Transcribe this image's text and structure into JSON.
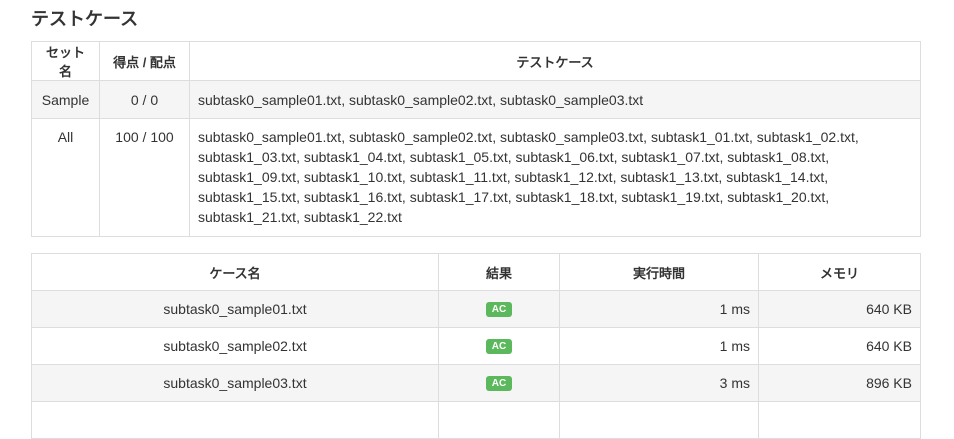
{
  "section_title": "テストケース",
  "sets_table": {
    "headers": [
      "セット名",
      "得点 / 配点",
      "テストケース"
    ],
    "rows": [
      {
        "name": "Sample",
        "score": "0 / 0",
        "cases": [
          "subtask0_sample01.txt",
          "subtask0_sample02.txt",
          "subtask0_sample03.txt"
        ]
      },
      {
        "name": "All",
        "score": "100 / 100",
        "cases": [
          "subtask0_sample01.txt",
          "subtask0_sample02.txt",
          "subtask0_sample03.txt",
          "subtask1_01.txt",
          "subtask1_02.txt",
          "subtask1_03.txt",
          "subtask1_04.txt",
          "subtask1_05.txt",
          "subtask1_06.txt",
          "subtask1_07.txt",
          "subtask1_08.txt",
          "subtask1_09.txt",
          "subtask1_10.txt",
          "subtask1_11.txt",
          "subtask1_12.txt",
          "subtask1_13.txt",
          "subtask1_14.txt",
          "subtask1_15.txt",
          "subtask1_16.txt",
          "subtask1_17.txt",
          "subtask1_18.txt",
          "subtask1_19.txt",
          "subtask1_20.txt",
          "subtask1_21.txt",
          "subtask1_22.txt"
        ]
      }
    ]
  },
  "results_table": {
    "headers": [
      "ケース名",
      "結果",
      "実行時間",
      "メモリ"
    ],
    "rows": [
      {
        "name": "subtask0_sample01.txt",
        "result": "AC",
        "time": "1 ms",
        "memory": "640 KB"
      },
      {
        "name": "subtask0_sample02.txt",
        "result": "AC",
        "time": "1 ms",
        "memory": "640 KB"
      },
      {
        "name": "subtask0_sample03.txt",
        "result": "AC",
        "time": "3 ms",
        "memory": "896 KB"
      }
    ]
  },
  "colors": {
    "ac_badge": "#5cb85c",
    "stripe": "#f5f5f5",
    "border": "#dddddd"
  }
}
